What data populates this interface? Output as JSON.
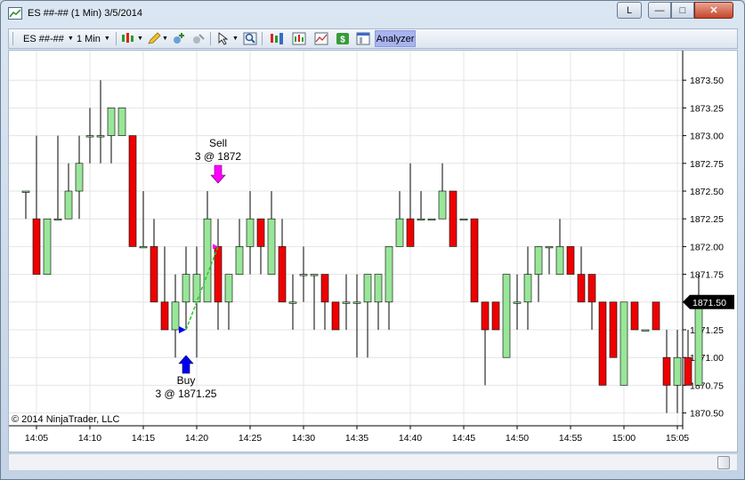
{
  "window": {
    "title": "ES ##-## (1 Min)  3/5/2014",
    "layout_button": "L",
    "minimize": "—",
    "maximize": "□",
    "close": "✕"
  },
  "toolbar": {
    "instrument": "ES ##-##",
    "interval": "1 Min",
    "analyzer_label": "Analyzer",
    "icons": [
      "bar-style-icon",
      "drawing-pencil-icon",
      "add-indicator-icon",
      "remove-indicator-icon",
      "cursor-select-icon",
      "zoom-icon",
      "strategy-icon",
      "chart-properties-icon",
      "performance-icon",
      "dollar-icon",
      "window-properties-icon"
    ]
  },
  "chart": {
    "copyright": "© 2014 NinjaTrader, LLC",
    "last_price_label": "1871.50",
    "colors": {
      "up": "#99e699",
      "down": "#ee0000",
      "wick": "#000000",
      "grid": "#e4e4e4",
      "price_marker": "#000000"
    },
    "sell_marker": {
      "line1": "Sell",
      "line2": "3 @ 1872",
      "color": "#ff00ff"
    },
    "buy_marker": {
      "line1": "Buy",
      "line2": "3 @ 1871.25",
      "color": "#0000ee"
    }
  },
  "chart_data": {
    "type": "candlestick",
    "y_ticks": [
      "1873.50",
      "1873.25",
      "1873.00",
      "1872.75",
      "1872.50",
      "1872.25",
      "1872.00",
      "1871.75",
      "1871.50",
      "1871.25",
      "1871.00",
      "1870.75",
      "1870.50"
    ],
    "x_ticks": [
      "14:05",
      "14:10",
      "14:15",
      "14:20",
      "14:25",
      "14:30",
      "14:35",
      "14:40",
      "14:45",
      "14:50",
      "14:55",
      "15:00",
      "15:05"
    ],
    "ylim": [
      1870.375,
      1873.75
    ],
    "bars": [
      {
        "t": "14:04",
        "o": 1872.5,
        "h": 1872.5,
        "l": 1872.25,
        "c": 1872.5
      },
      {
        "t": "14:05",
        "o": 1872.25,
        "h": 1873.0,
        "l": 1871.75,
        "c": 1871.75
      },
      {
        "t": "14:06",
        "o": 1871.75,
        "h": 1872.25,
        "l": 1871.75,
        "c": 1872.25
      },
      {
        "t": "14:07",
        "o": 1872.25,
        "h": 1873.0,
        "l": 1872.25,
        "c": 1872.25
      },
      {
        "t": "14:08",
        "o": 1872.25,
        "h": 1872.75,
        "l": 1872.25,
        "c": 1872.5
      },
      {
        "t": "14:09",
        "o": 1872.5,
        "h": 1873.0,
        "l": 1872.25,
        "c": 1872.75
      },
      {
        "t": "14:10",
        "o": 1873.0,
        "h": 1873.25,
        "l": 1872.75,
        "c": 1873.0
      },
      {
        "t": "14:11",
        "o": 1873.0,
        "h": 1873.5,
        "l": 1872.75,
        "c": 1873.0
      },
      {
        "t": "14:12",
        "o": 1873.0,
        "h": 1873.25,
        "l": 1872.75,
        "c": 1873.25
      },
      {
        "t": "14:13",
        "o": 1873.0,
        "h": 1873.25,
        "l": 1873.0,
        "c": 1873.25
      },
      {
        "t": "14:14",
        "o": 1873.0,
        "h": 1873.0,
        "l": 1872.0,
        "c": 1872.0
      },
      {
        "t": "14:15",
        "o": 1872.0,
        "h": 1872.5,
        "l": 1872.0,
        "c": 1872.0
      },
      {
        "t": "14:16",
        "o": 1872.0,
        "h": 1872.25,
        "l": 1871.5,
        "c": 1871.5
      },
      {
        "t": "14:17",
        "o": 1871.5,
        "h": 1872.0,
        "l": 1871.25,
        "c": 1871.25
      },
      {
        "t": "14:18",
        "o": 1871.25,
        "h": 1871.75,
        "l": 1871.0,
        "c": 1871.5
      },
      {
        "t": "14:19",
        "o": 1871.5,
        "h": 1872.0,
        "l": 1871.25,
        "c": 1871.75
      },
      {
        "t": "14:20",
        "o": 1871.5,
        "h": 1872.0,
        "l": 1871.0,
        "c": 1871.75
      },
      {
        "t": "14:21",
        "o": 1871.5,
        "h": 1872.5,
        "l": 1871.5,
        "c": 1872.25
      },
      {
        "t": "14:22",
        "o": 1872.0,
        "h": 1872.25,
        "l": 1871.25,
        "c": 1871.5
      },
      {
        "t": "14:23",
        "o": 1871.5,
        "h": 1871.75,
        "l": 1871.25,
        "c": 1871.75
      },
      {
        "t": "14:24",
        "o": 1871.75,
        "h": 1872.25,
        "l": 1871.75,
        "c": 1872.0
      },
      {
        "t": "14:25",
        "o": 1872.0,
        "h": 1872.5,
        "l": 1871.75,
        "c": 1872.25
      },
      {
        "t": "14:26",
        "o": 1872.25,
        "h": 1872.25,
        "l": 1871.75,
        "c": 1872.0
      },
      {
        "t": "14:27",
        "o": 1871.75,
        "h": 1872.5,
        "l": 1871.75,
        "c": 1872.25
      },
      {
        "t": "14:28",
        "o": 1872.0,
        "h": 1872.25,
        "l": 1871.5,
        "c": 1871.5
      },
      {
        "t": "14:29",
        "o": 1871.5,
        "h": 1871.75,
        "l": 1871.25,
        "c": 1871.5
      },
      {
        "t": "14:30",
        "o": 1871.75,
        "h": 1872.0,
        "l": 1871.5,
        "c": 1871.75
      },
      {
        "t": "14:31",
        "o": 1871.75,
        "h": 1871.75,
        "l": 1871.25,
        "c": 1871.75
      },
      {
        "t": "14:32",
        "o": 1871.75,
        "h": 1871.75,
        "l": 1871.25,
        "c": 1871.5
      },
      {
        "t": "14:33",
        "o": 1871.5,
        "h": 1871.5,
        "l": 1871.25,
        "c": 1871.25
      },
      {
        "t": "14:34",
        "o": 1871.5,
        "h": 1871.75,
        "l": 1871.25,
        "c": 1871.5
      },
      {
        "t": "14:35",
        "o": 1871.5,
        "h": 1871.75,
        "l": 1871.0,
        "c": 1871.5
      },
      {
        "t": "14:36",
        "o": 1871.5,
        "h": 1871.75,
        "l": 1871.0,
        "c": 1871.75
      },
      {
        "t": "14:37",
        "o": 1871.5,
        "h": 1871.75,
        "l": 1871.25,
        "c": 1871.75
      },
      {
        "t": "14:38",
        "o": 1871.5,
        "h": 1872.0,
        "l": 1871.25,
        "c": 1872.0
      },
      {
        "t": "14:39",
        "o": 1872.0,
        "h": 1872.5,
        "l": 1872.0,
        "c": 1872.25
      },
      {
        "t": "14:40",
        "o": 1872.25,
        "h": 1872.75,
        "l": 1872.0,
        "c": 1872.0
      },
      {
        "t": "14:41",
        "o": 1872.25,
        "h": 1872.5,
        "l": 1872.25,
        "c": 1872.25
      },
      {
        "t": "14:42",
        "o": 1872.25,
        "h": 1872.25,
        "l": 1872.25,
        "c": 1872.25
      },
      {
        "t": "14:43",
        "o": 1872.25,
        "h": 1872.75,
        "l": 1872.25,
        "c": 1872.5
      },
      {
        "t": "14:44",
        "o": 1872.5,
        "h": 1872.5,
        "l": 1872.0,
        "c": 1872.0
      },
      {
        "t": "14:45",
        "o": 1872.25,
        "h": 1872.25,
        "l": 1872.25,
        "c": 1872.25
      },
      {
        "t": "14:46",
        "o": 1872.25,
        "h": 1872.25,
        "l": 1871.5,
        "c": 1871.5
      },
      {
        "t": "14:47",
        "o": 1871.5,
        "h": 1871.5,
        "l": 1870.75,
        "c": 1871.25
      },
      {
        "t": "14:48",
        "o": 1871.5,
        "h": 1871.5,
        "l": 1871.25,
        "c": 1871.25
      },
      {
        "t": "14:49",
        "o": 1871.0,
        "h": 1871.75,
        "l": 1871.0,
        "c": 1871.75
      },
      {
        "t": "14:50",
        "o": 1871.5,
        "h": 1871.75,
        "l": 1871.25,
        "c": 1871.5
      },
      {
        "t": "14:51",
        "o": 1871.5,
        "h": 1872.0,
        "l": 1871.25,
        "c": 1871.75
      },
      {
        "t": "14:52",
        "o": 1871.75,
        "h": 1872.0,
        "l": 1871.5,
        "c": 1872.0
      },
      {
        "t": "14:53",
        "o": 1872.0,
        "h": 1872.0,
        "l": 1871.75,
        "c": 1872.0
      },
      {
        "t": "14:54",
        "o": 1871.75,
        "h": 1872.25,
        "l": 1871.75,
        "c": 1872.0
      },
      {
        "t": "14:55",
        "o": 1872.0,
        "h": 1872.0,
        "l": 1871.75,
        "c": 1871.75
      },
      {
        "t": "14:56",
        "o": 1871.75,
        "h": 1872.0,
        "l": 1871.5,
        "c": 1871.5
      },
      {
        "t": "14:57",
        "o": 1871.75,
        "h": 1871.75,
        "l": 1871.25,
        "c": 1871.5
      },
      {
        "t": "14:58",
        "o": 1871.5,
        "h": 1871.5,
        "l": 1870.75,
        "c": 1870.75
      },
      {
        "t": "14:59",
        "o": 1871.5,
        "h": 1871.5,
        "l": 1871.0,
        "c": 1871.0
      },
      {
        "t": "15:00",
        "o": 1870.75,
        "h": 1871.5,
        "l": 1870.75,
        "c": 1871.5
      },
      {
        "t": "15:01",
        "o": 1871.5,
        "h": 1871.5,
        "l": 1871.25,
        "c": 1871.25
      },
      {
        "t": "15:02",
        "o": 1871.25,
        "h": 1871.25,
        "l": 1871.25,
        "c": 1871.25
      },
      {
        "t": "15:03",
        "o": 1871.5,
        "h": 1871.5,
        "l": 1871.25,
        "c": 1871.25
      },
      {
        "t": "15:04",
        "o": 1871.0,
        "h": 1871.25,
        "l": 1870.5,
        "c": 1870.75
      },
      {
        "t": "15:05",
        "o": 1870.75,
        "h": 1871.25,
        "l": 1870.5,
        "c": 1871.0
      },
      {
        "t": "15:06",
        "o": 1871.0,
        "h": 1871.25,
        "l": 1870.75,
        "c": 1870.75
      },
      {
        "t": "15:07",
        "o": 1870.75,
        "h": 1871.75,
        "l": 1870.75,
        "c": 1871.5
      }
    ],
    "trades": [
      {
        "side": "buy",
        "t": "14:19",
        "price": 1871.25,
        "qty": 3
      },
      {
        "side": "sell",
        "t": "14:22",
        "price": 1872.0,
        "qty": 3
      }
    ]
  }
}
